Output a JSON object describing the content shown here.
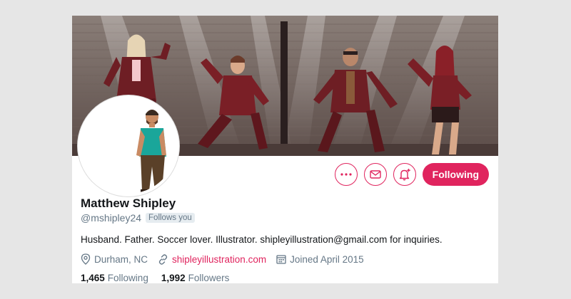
{
  "profile": {
    "display_name": "Matthew Shipley",
    "handle": "@mshipley24",
    "follows_you_badge": "Follows you",
    "bio": "Husband. Father. Soccer lover. Illustrator. shipleyillustration@gmail.com for inquiries.",
    "location": "Durham, NC",
    "website": "shipleyillustration.com",
    "joined": "Joined April 2015"
  },
  "actions": {
    "more_icon": "more-icon",
    "message_icon": "envelope-icon",
    "notify_icon": "bell-plus-icon",
    "following_label": "Following"
  },
  "stats": {
    "following_count": "1,465",
    "following_label": "Following",
    "followers_count": "1,992",
    "followers_label": "Followers"
  },
  "icons": {
    "location": "map-pin-icon",
    "website": "link-icon",
    "joined": "calendar-icon"
  },
  "colors": {
    "accent": "#e0245e",
    "text_primary": "#14171a",
    "text_secondary": "#657786",
    "badge_bg": "#e6ecf0",
    "page_bg": "#e6e6e6"
  }
}
